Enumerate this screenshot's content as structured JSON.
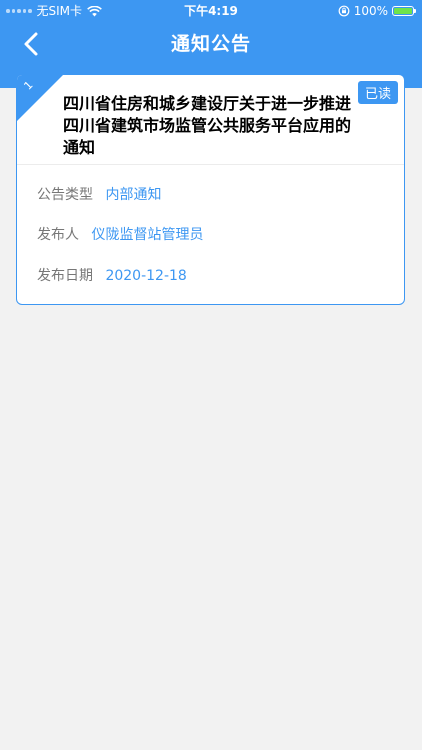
{
  "status_bar": {
    "carrier": "无SIM卡",
    "time": "下午4:19",
    "battery_percent": "100%",
    "icons": [
      "signal-dots-icon",
      "wifi-icon",
      "orientation-lock-icon",
      "battery-charging-icon"
    ]
  },
  "nav": {
    "title": "通知公告",
    "back_icon": "chevron-left-icon"
  },
  "notice": {
    "index": "1",
    "read_status": "已读",
    "title": "四川省住房和城乡建设厅关于进一步推进四川省建筑市场监管公共服务平台应用的通知",
    "fields": {
      "type_label": "公告类型",
      "type_value": "内部通知",
      "publisher_label": "发布人",
      "publisher_value": "仪陇监督站管理员",
      "date_label": "发布日期",
      "date_value": "2020-12-18"
    }
  },
  "colors": {
    "primary": "#3d97f2",
    "background": "#f2f2f2",
    "label": "#777777",
    "battery": "#6fe34b"
  }
}
